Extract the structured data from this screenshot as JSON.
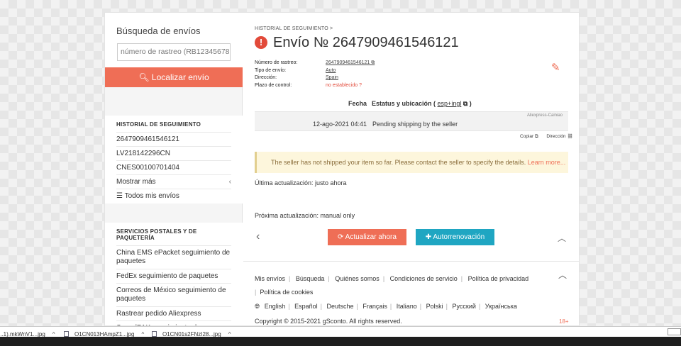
{
  "sidebar": {
    "title": "Búsqueda de envíos",
    "search_placeholder": "número de rastreo (RB1234567890",
    "search_button": "Localizar envío",
    "history_heading": "HISTORIAL DE SEGUIMIENTO",
    "history_items": [
      "2647909461546121",
      "LV218142296CN",
      "CNES00100701404",
      "Mostrar más",
      "Todos mis envíos"
    ],
    "services_heading": "SERVICIOS POSTALES Y DE PAQUETERÍA",
    "services_items": [
      "China EMS ePacket seguimiento de paquetes",
      "FedEx seguimiento de paquetes",
      "Correos de México seguimiento de paquetes",
      "Rastrear pedido Aliexpress",
      "SpeedPAK seguimiento de paquetes"
    ]
  },
  "main": {
    "breadcrumb": "HISTORIAL DE SEGUIMIENTO  >",
    "title": "Envío № 2647909461546121",
    "meta": [
      {
        "key": "Número de rastreo:",
        "value": "2647909461546121 ⧉"
      },
      {
        "key": "Tipo de envío:",
        "value": "Auto"
      },
      {
        "key": "Dirección:",
        "value": "Spain"
      },
      {
        "key": "Plazo de control:",
        "value": "no establecido ?"
      }
    ],
    "col_fecha": "Fecha",
    "col_estatus": "Estatus y ubicación (",
    "col_lang": "esp+ingl",
    "col_close": "⧉ )",
    "event_source": "Aliexpress-Cainiao",
    "event_date": "12-ago-2021 04:41",
    "event_status": "Pending shipping by the seller",
    "copy_label": "Copiar ⧉",
    "direction_label": "Dirección ⛓",
    "warning_text": "The seller has not shipped your item so far. Please contact the seller to specify the details. ",
    "warning_link": "Learn more...",
    "last_update": "Última actualización: justo ahora",
    "next_update": "Próxima actualización: manual only",
    "refresh_button": "Actualizar ahora",
    "autorenew_button": "Autorrenovación"
  },
  "footer": {
    "links": [
      "Mis envíos",
      "Búsqueda",
      "Quiénes somos",
      "Condiciones de servicio",
      "Política de privacidad",
      "Política de cookies"
    ],
    "languages": [
      "English",
      "Español",
      "Deutsche",
      "Français",
      "Italiano",
      "Polski",
      "Русский",
      "Українська"
    ],
    "copyright": "Copyright © 2015-2021 gSconto. All rights reserved.",
    "age": "18+"
  },
  "downloads": [
    {
      "name": "...1).mkWnV1...jpg"
    },
    {
      "name": "O1CN013HAmpZ1...jpg"
    },
    {
      "name": "O1CN01s2FNzI28...jpg"
    }
  ],
  "icons": {
    "alert": "exclamation-circle-icon",
    "search": "search-icon",
    "edit": "pencil-icon",
    "refresh": "refresh-icon",
    "plus": "plus-icon",
    "globe": "globe-icon"
  },
  "colors": {
    "accent": "#ef6e56",
    "teal": "#1fa6c2",
    "alert": "#e24a3a"
  }
}
